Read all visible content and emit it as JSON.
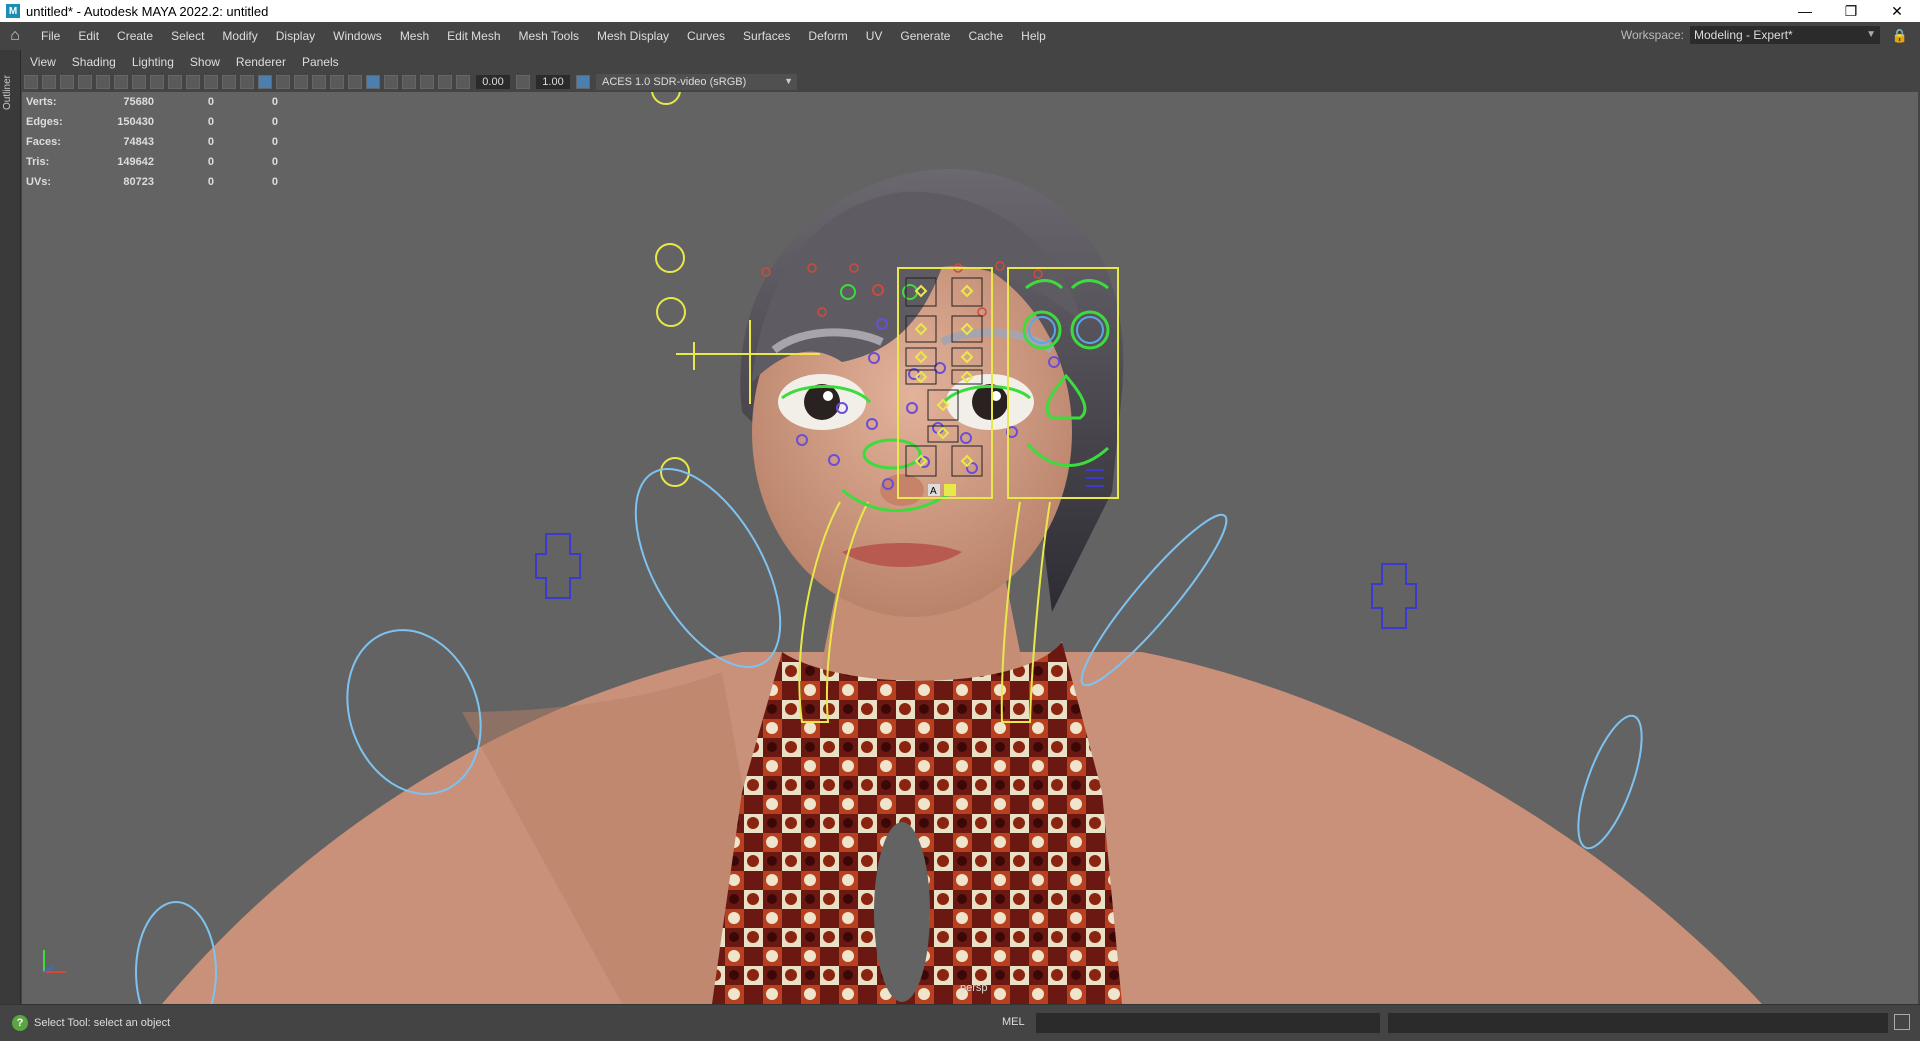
{
  "window": {
    "title": "untitled* - Autodesk MAYA 2022.2: untitled",
    "app_icon": "maya-icon"
  },
  "menubar": {
    "items": [
      "File",
      "Edit",
      "Create",
      "Select",
      "Modify",
      "Display",
      "Windows",
      "Mesh",
      "Edit Mesh",
      "Mesh Tools",
      "Mesh Display",
      "Curves",
      "Surfaces",
      "Deform",
      "UV",
      "Generate",
      "Cache",
      "Help"
    ]
  },
  "workspace": {
    "label": "Workspace:",
    "value": "Modeling - Expert*"
  },
  "outliner_tab": "Outliner",
  "panel_menu": [
    "View",
    "Shading",
    "Lighting",
    "Show",
    "Renderer",
    "Panels"
  ],
  "panel_toolbar": {
    "exposure": "0.00",
    "gamma": "1.00",
    "color_management": "ACES 1.0 SDR-video (sRGB)"
  },
  "hud": {
    "rows": [
      {
        "label": "Verts:",
        "v1": "75680",
        "v2": "0",
        "v3": "0"
      },
      {
        "label": "Edges:",
        "v1": "150430",
        "v2": "0",
        "v3": "0"
      },
      {
        "label": "Faces:",
        "v1": "74843",
        "v2": "0",
        "v3": "0"
      },
      {
        "label": "Tris:",
        "v1": "149642",
        "v2": "0",
        "v3": "0"
      },
      {
        "label": "UVs:",
        "v1": "80723",
        "v2": "0",
        "v3": "0"
      }
    ]
  },
  "viewport": {
    "camera_label": "persp",
    "picker_button_label": "A"
  },
  "statusbar": {
    "help_text": "Select Tool: select an object",
    "mel_label": "MEL"
  },
  "colors": {
    "viewport_bg": "#636363",
    "ui_bg": "#444444",
    "control_yellow": "#e8e84a",
    "control_green": "#3ddc3d",
    "control_blue": "#3a3ad0",
    "control_lightblue": "#7ec3f0"
  }
}
